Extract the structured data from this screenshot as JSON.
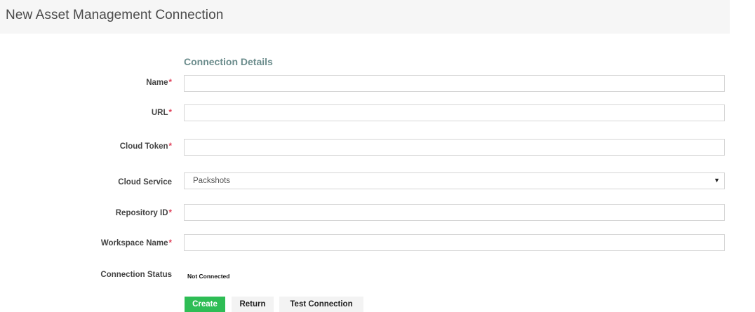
{
  "header": {
    "title": "New Asset Management Connection"
  },
  "form": {
    "section_title": "Connection Details",
    "required_marker": "*",
    "fields": {
      "name": {
        "label": "Name",
        "value": ""
      },
      "url": {
        "label": "URL",
        "value": ""
      },
      "cloud_token": {
        "label": "Cloud Token",
        "value": ""
      },
      "cloud_service": {
        "label": "Cloud Service",
        "selected": "Packshots"
      },
      "repository_id": {
        "label": "Repository ID",
        "value": ""
      },
      "workspace_name": {
        "label": "Workspace Name",
        "value": ""
      },
      "connection_status": {
        "label": "Connection Status",
        "value": "Not Connected"
      }
    }
  },
  "actions": {
    "create_label": "Create",
    "return_label": "Return",
    "test_label": "Test Connection"
  },
  "colors": {
    "accent_green": "#2ebd55",
    "required_red": "#e0415a",
    "section_heading": "#6b8c8c"
  },
  "icons": {
    "dropdown_caret": "caret-down-icon"
  }
}
